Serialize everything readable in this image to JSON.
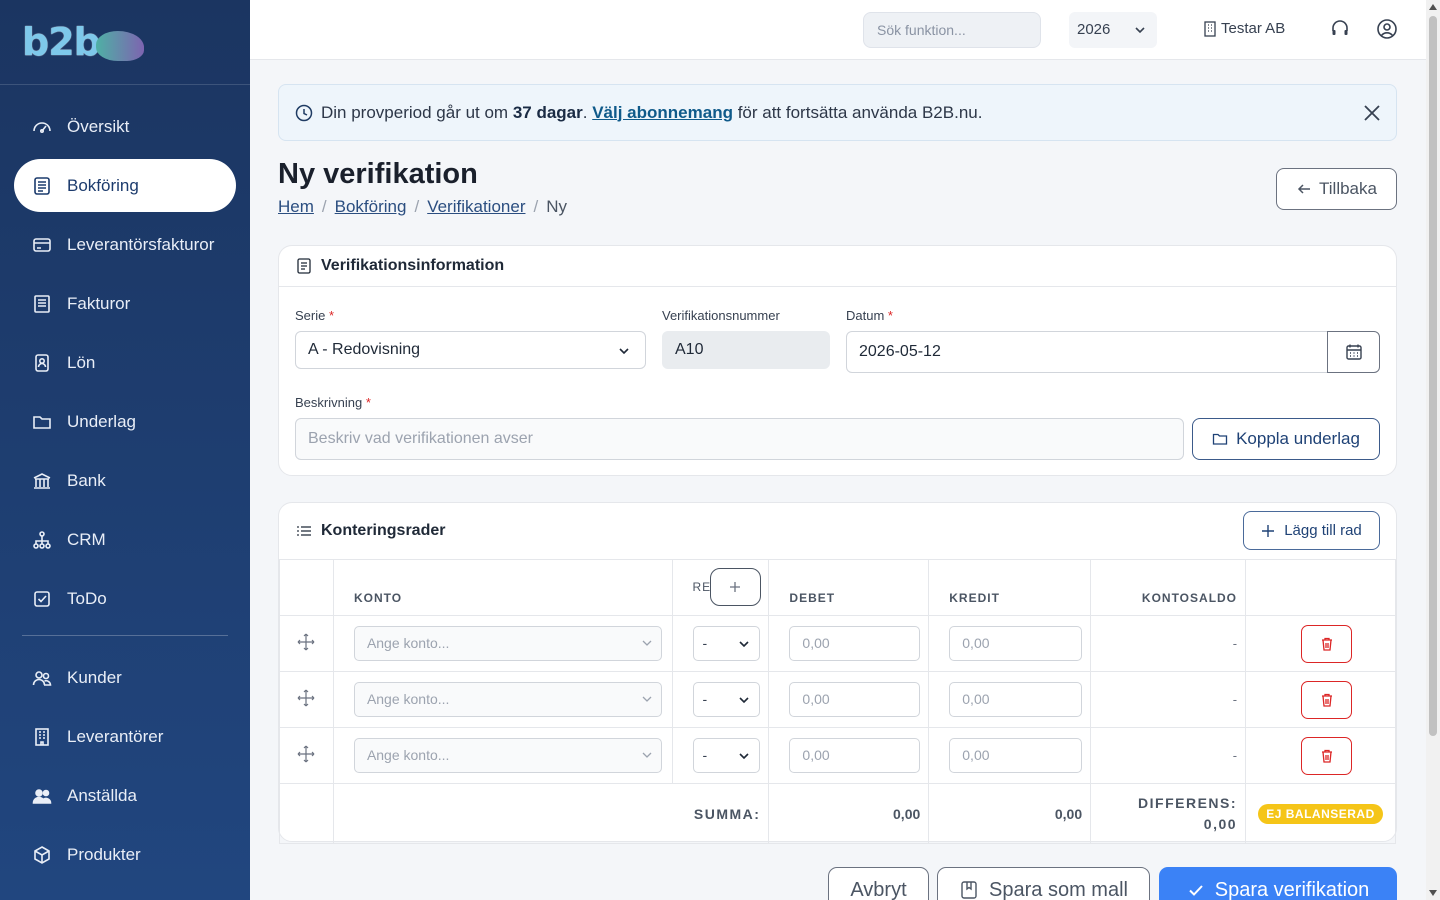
{
  "sidebar": {
    "logo": "b2b",
    "items": [
      {
        "label": "Översikt",
        "icon": "dashboard-icon",
        "active": false
      },
      {
        "label": "Bokföring",
        "icon": "ledger-icon",
        "active": true
      },
      {
        "label": "Leverantörsfakturor",
        "icon": "credit-card-icon",
        "active": false
      },
      {
        "label": "Fakturor",
        "icon": "invoice-icon",
        "active": false
      },
      {
        "label": "Lön",
        "icon": "payroll-icon",
        "active": false
      },
      {
        "label": "Underlag",
        "icon": "folder-icon",
        "active": false
      },
      {
        "label": "Bank",
        "icon": "bank-icon",
        "active": false
      },
      {
        "label": "CRM",
        "icon": "network-icon",
        "active": false
      },
      {
        "label": "ToDo",
        "icon": "checkbox-icon",
        "active": false
      }
    ],
    "items2": [
      {
        "label": "Kunder",
        "icon": "customers-icon"
      },
      {
        "label": "Leverantörer",
        "icon": "building-icon"
      },
      {
        "label": "Anställda",
        "icon": "employees-icon"
      },
      {
        "label": "Produkter",
        "icon": "box-icon"
      }
    ]
  },
  "topbar": {
    "search_placeholder": "Sök funktion...",
    "year": "2026",
    "company": "Testar AB"
  },
  "banner": {
    "pre": "Din provperiod går ut om ",
    "days": "37 dagar",
    "mid": ". ",
    "link": "Välj abonnemang",
    "post": " för att fortsätta använda B2B.nu."
  },
  "page": {
    "title": "Ny verifikation",
    "breadcrumb": [
      "Hem",
      "Bokföring",
      "Verifikationer",
      "Ny"
    ],
    "back_label": "Tillbaka"
  },
  "info_card": {
    "title": "Verifikationsinformation",
    "serie_label": "Serie",
    "serie_value": "A - Redovisning",
    "nummer_label": "Verifikationsnummer",
    "nummer_value": "A10",
    "datum_label": "Datum",
    "datum_value": "2026-05-12",
    "beskrivning_label": "Beskrivning",
    "beskrivning_placeholder": "Beskriv vad verifikationen avser",
    "koppla_label": "Koppla underlag"
  },
  "rows_card": {
    "title": "Konteringsrader",
    "add_row_label": "Lägg till rad",
    "columns": [
      "KONTO",
      "RE",
      "DEBET",
      "KREDIT",
      "KONTOSALDO"
    ],
    "rows": [
      {
        "account_placeholder": "Ange konto...",
        "re": "-",
        "debet": "0,00",
        "kredit": "0,00",
        "saldo": "-"
      },
      {
        "account_placeholder": "Ange konto...",
        "re": "-",
        "debet": "0,00",
        "kredit": "0,00",
        "saldo": "-"
      },
      {
        "account_placeholder": "Ange konto...",
        "re": "-",
        "debet": "0,00",
        "kredit": "0,00",
        "saldo": "-"
      }
    ],
    "summa_label": "SUMMA:",
    "summa_debet": "0,00",
    "summa_kredit": "0,00",
    "differens_label": "DIFFERENS:",
    "differens_value": "0,00",
    "status_badge": "EJ BALANSERAD"
  },
  "actions": {
    "cancel": "Avbryt",
    "save_template": "Spara som mall",
    "save": "Spara verifikation"
  },
  "colors": {
    "sidebar": "#1b3561",
    "primary": "#3b82f6",
    "danger": "#dc2626",
    "warning": "#f5c518"
  }
}
